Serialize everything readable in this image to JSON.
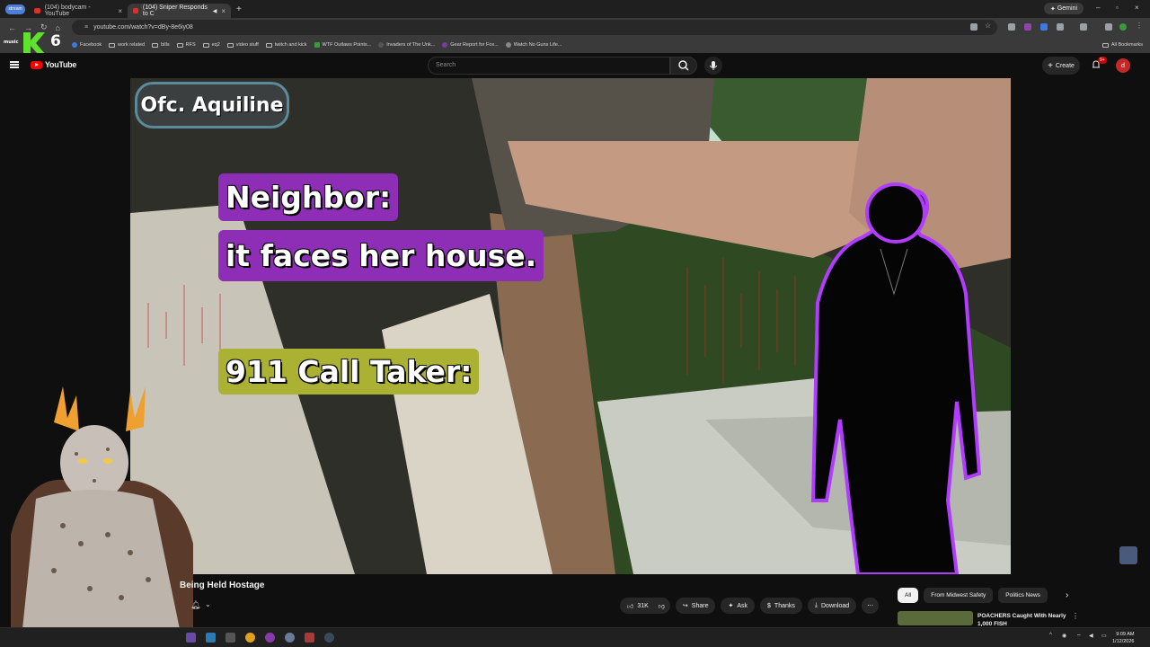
{
  "browser": {
    "stream_pill": "stream",
    "tabs": [
      {
        "title": "(104) bodycam - YouTube",
        "active": false
      },
      {
        "title": "(104) Sniper Responds to C",
        "active": true
      }
    ],
    "gemini_label": "Gemini",
    "url": "youtube.com/watch?v=dBy-8e6iy08",
    "bookmarks": [
      {
        "label": "Facebook",
        "icon": "facebook-icon"
      },
      {
        "label": "work related",
        "icon": "folder-icon"
      },
      {
        "label": "bills",
        "icon": "folder-icon"
      },
      {
        "label": "RFS",
        "icon": "folder-icon"
      },
      {
        "label": "eq2",
        "icon": "folder-icon"
      },
      {
        "label": "video stuff",
        "icon": "folder-icon"
      },
      {
        "label": "twitch and kick",
        "icon": "folder-icon"
      },
      {
        "label": "WTF Outlaws Points...",
        "icon": "site-icon"
      },
      {
        "label": "Invaders of The Unk...",
        "icon": "site-icon"
      },
      {
        "label": "Gear Report for Fox...",
        "icon": "site-icon"
      },
      {
        "label": "Watch No Guns Life...",
        "icon": "site-icon"
      }
    ],
    "all_bookmarks": "All Bookmarks",
    "mascot_text": "6",
    "mascot_small": "music"
  },
  "youtube": {
    "logo_text": "YouTube",
    "search_placeholder": "Search",
    "create_label": "Create",
    "notification_count": "9+",
    "avatar_letter": "d"
  },
  "video": {
    "overlays": {
      "officer": "Ofc. Aquiline",
      "speaker_neighbor": "Neighbor:",
      "quote": "it faces her house.",
      "speaker_taker": "911 Call Taker:"
    },
    "colors": {
      "neighbor_bg": "#8e2db5",
      "taker_bg": "#aab133",
      "officer_border": "#5b8a9a",
      "silhouette_glow": "#b13cff"
    }
  },
  "below_player": {
    "title": "Being Held Hostage",
    "actions": {
      "like_count": "31K",
      "share": "Share",
      "ask": "Ask",
      "thanks": "Thanks",
      "download": "Download"
    },
    "chips": [
      {
        "label": "All",
        "active": true
      },
      {
        "label": "From Midwest Safety",
        "active": false
      },
      {
        "label": "Politics News",
        "active": false
      }
    ],
    "recommended": {
      "title": "POACHERS Caught With Nearly 1,000 FISH"
    }
  },
  "taskbar": {
    "time": "9:09 AM",
    "date": "1/12/2026"
  }
}
